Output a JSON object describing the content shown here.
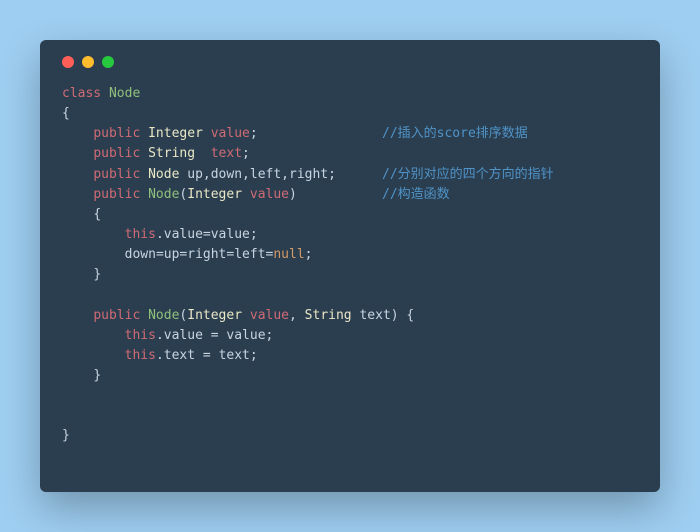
{
  "code": {
    "kw_class": "class",
    "cls_name": "Node",
    "brace_open": "{",
    "brace_close": "}",
    "kw_public": "public",
    "type_Integer": "Integer",
    "type_String": "String",
    "type_Node": "Node",
    "fld_value": "value",
    "fld_text": "text",
    "fld_dirs": "up,down,left,right",
    "semi": ";",
    "paren_open": "(",
    "paren_close": ")",
    "comma": ",",
    "kw_this": "this",
    "dot": ".",
    "eq": "=",
    "space_eq": " = ",
    "kw_null": "null",
    "assign_chain_left": "down",
    "assign_chain_up": "up",
    "assign_chain_right": "right",
    "assign_chain_left2": "left",
    "param_text": "text",
    "brace_open_sp": " {",
    "cmt1": "//插入的score排序数据",
    "cmt2": "//分别对应的四个方向的指针",
    "cmt3": "//构造函数",
    "sp4": "    ",
    "sp8": "        ",
    "sp2": "  ",
    "sp1": " "
  }
}
